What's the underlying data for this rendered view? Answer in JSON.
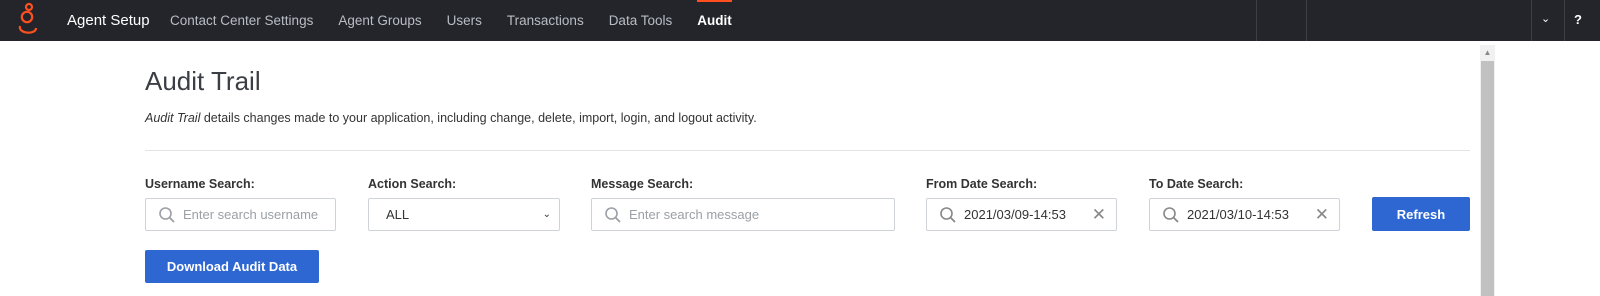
{
  "nav": {
    "brand": "Agent Setup",
    "items": [
      {
        "label": "Contact Center Settings",
        "active": false
      },
      {
        "label": "Agent Groups",
        "active": false
      },
      {
        "label": "Users",
        "active": false
      },
      {
        "label": "Transactions",
        "active": false
      },
      {
        "label": "Data Tools",
        "active": false
      },
      {
        "label": "Audit",
        "active": true
      }
    ],
    "caret": "⌄",
    "help": "?"
  },
  "page": {
    "title": "Audit Trail",
    "desc_em": "Audit Trail",
    "desc_rest": " details changes made to your application, including change, delete, import, login, and logout activity."
  },
  "filters": {
    "username": {
      "label": "Username Search:",
      "placeholder": "Enter search username",
      "value": ""
    },
    "action": {
      "label": "Action Search:",
      "selected": "ALL"
    },
    "message": {
      "label": "Message Search:",
      "placeholder": "Enter search message",
      "value": ""
    },
    "from_date": {
      "label": "From Date Search:",
      "value": "2021/03/09-14:53"
    },
    "to_date": {
      "label": "To Date Search:",
      "value": "2021/03/10-14:53"
    }
  },
  "buttons": {
    "refresh": "Refresh",
    "download": "Download Audit Data"
  },
  "icons": {
    "logo": "genesys-logo-icon",
    "search": "search-icon",
    "clear": "close-icon"
  },
  "colors": {
    "nav_bg": "#23252b",
    "accent": "#ff4f1f",
    "primary_button": "#2e67d1"
  }
}
